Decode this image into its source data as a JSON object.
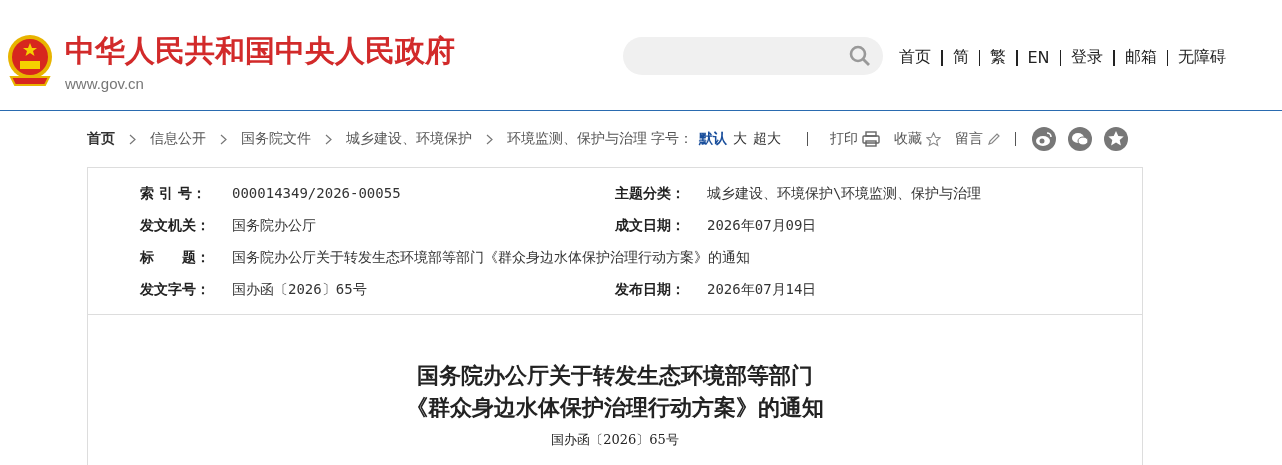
{
  "header": {
    "site_title": "中华人民共和国中央人民政府",
    "site_url": "www.gov.cn",
    "nav_links": [
      "首页",
      "简",
      "繁",
      "EN",
      "登录",
      "邮箱",
      "无障碍"
    ]
  },
  "breadcrumb": [
    "首页",
    "信息公开",
    "国务院文件",
    "城乡建设、环境保护",
    "环境监测、保护与治理"
  ],
  "font_size": {
    "label": "字号：",
    "options": [
      {
        "label": "默认",
        "selected": true
      },
      {
        "label": "大",
        "selected": false
      },
      {
        "label": "超大",
        "selected": false
      }
    ]
  },
  "actions": [
    {
      "label": "打印",
      "kind": "print"
    },
    {
      "label": "收藏",
      "kind": "star"
    },
    {
      "label": "留言",
      "kind": "pencil"
    }
  ],
  "share_icons": [
    {
      "kind": "swirl"
    },
    {
      "kind": "chat"
    },
    {
      "kind": "star"
    }
  ],
  "meta": [
    {
      "label": "索 引 号：",
      "value": "000014349/2026-00055",
      "kind": "half"
    },
    {
      "label": "主题分类：",
      "value": "城乡建设、环境保护\\环境监测、保护与治理",
      "kind": "half"
    },
    {
      "label": "发文机关：",
      "value": "国务院办公厅",
      "kind": "half"
    },
    {
      "label": "成文日期：",
      "value": "2026年07月09日",
      "kind": "half"
    },
    {
      "label": "标　　题：",
      "value": "国务院办公厅关于转发生态环境部等部门《群众身边水体保护治理行动方案》的通知",
      "kind": "full"
    },
    {
      "label": "发文字号：",
      "value": "国办函〔2026〕65号",
      "kind": "half"
    },
    {
      "label": "发布日期：",
      "value": "2026年07月14日",
      "kind": "half"
    }
  ],
  "article": {
    "title_lines": [
      "国务院办公厅关于转发生态环境部等部门",
      "《群众身边水体保护治理行动方案》的通知"
    ],
    "doc_number": "国办函〔2026〕65号"
  }
}
